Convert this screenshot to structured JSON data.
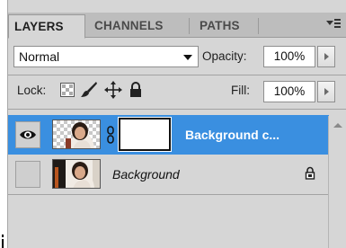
{
  "tabs": [
    {
      "label": "LAYERS",
      "active": true
    },
    {
      "label": "CHANNELS",
      "active": false
    },
    {
      "label": "PATHS",
      "active": false
    }
  ],
  "blend_mode": {
    "value": "Normal"
  },
  "opacity": {
    "label": "Opacity:",
    "value": "100%"
  },
  "lock": {
    "label": "Lock:"
  },
  "fill": {
    "label": "Fill:",
    "value": "100%"
  },
  "layers": [
    {
      "name": "Background c...",
      "selected": true,
      "visible": true,
      "has_mask": true,
      "locked": false
    },
    {
      "name": "Background",
      "selected": false,
      "visible": false,
      "has_mask": false,
      "locked": true
    }
  ],
  "colors": {
    "selection": "#3a8fe0",
    "panel": "#d6d6d6",
    "tabbar": "#bdbdbd"
  },
  "icons": [
    "panel-menu-icon",
    "dropdown-caret-icon",
    "lock-transparent-icon",
    "lock-paint-icon",
    "lock-move-icon",
    "lock-all-icon",
    "eye-icon",
    "chain-link-icon",
    "lock-icon",
    "scroll-up-icon"
  ]
}
